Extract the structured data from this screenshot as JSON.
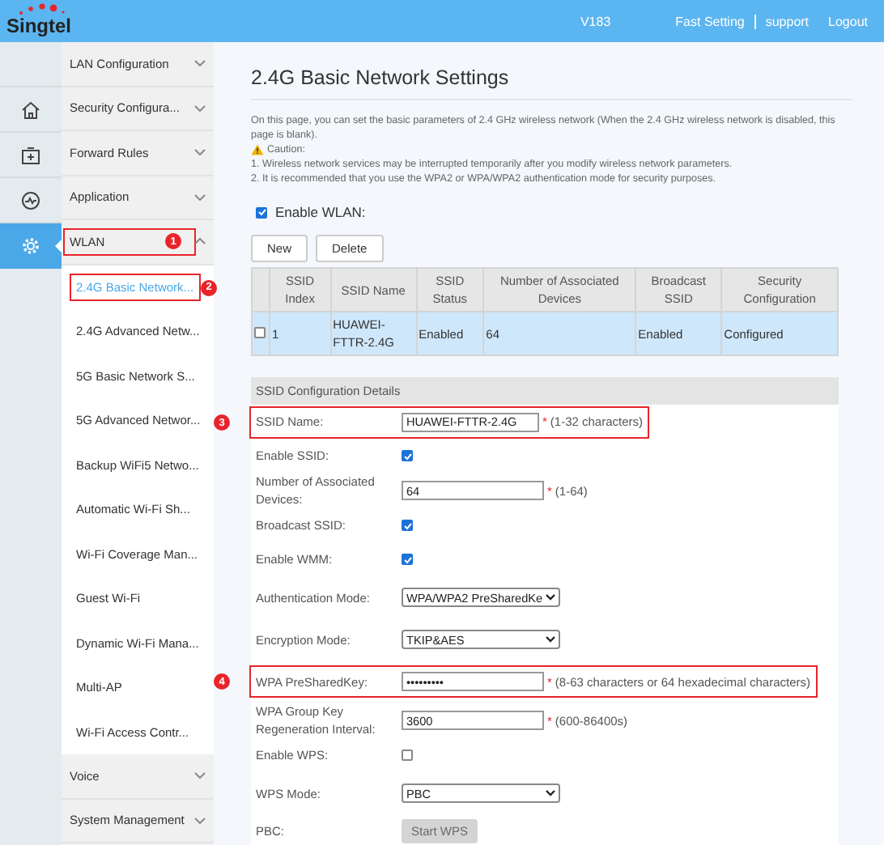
{
  "header": {
    "brand": "Singtel",
    "version": "V183",
    "links": [
      "Fast Setting",
      "support",
      "Logout"
    ]
  },
  "rail": [
    {
      "selected": false
    },
    {
      "selected": false
    },
    {
      "selected": false
    },
    {
      "selected": false
    },
    {
      "selected": true
    }
  ],
  "menu": [
    {
      "label": "LAN Configuration",
      "expanded": false
    },
    {
      "label": "Security Configura...",
      "expanded": false
    },
    {
      "label": "Forward Rules",
      "expanded": false
    },
    {
      "label": "Application",
      "expanded": false
    },
    {
      "label": "WLAN",
      "expanded": true,
      "annotation": "1",
      "children": [
        {
          "label": "2.4G Basic Network...",
          "selected": true,
          "annotation": "2"
        },
        {
          "label": "2.4G Advanced Netw...",
          "selected": false
        },
        {
          "label": "5G Basic Network S...",
          "selected": false
        },
        {
          "label": "5G Advanced Networ...",
          "selected": false
        },
        {
          "label": "Backup WiFi5 Netwo...",
          "selected": false
        },
        {
          "label": "Automatic Wi-Fi Sh...",
          "selected": false
        },
        {
          "label": "Wi-Fi Coverage Man...",
          "selected": false
        },
        {
          "label": "Guest Wi-Fi",
          "selected": false
        },
        {
          "label": "Dynamic Wi-Fi Mana...",
          "selected": false
        },
        {
          "label": "Multi-AP",
          "selected": false
        },
        {
          "label": "Wi-Fi Access Contr...",
          "selected": false
        }
      ]
    },
    {
      "label": "Voice",
      "expanded": false
    },
    {
      "label": "System Management",
      "expanded": false
    }
  ],
  "page": {
    "title": "2.4G Basic Network Settings",
    "intro": "On this page, you can set the basic parameters of 2.4 GHz wireless network (When the 2.4 GHz wireless network is disabled, this page is blank).",
    "caution": "Caution:",
    "notes": [
      "1. Wireless network services may be interrupted temporarily after you modify wireless network parameters.",
      "2. It is recommended that you use the WPA2 or WPA/WPA2 authentication mode for security purposes."
    ],
    "enable_wlan": {
      "label": "Enable WLAN:",
      "checked": true
    },
    "buttons": [
      "New",
      "Delete"
    ],
    "table": {
      "columns": [
        "SSID Index",
        "SSID Name",
        "SSID Status",
        "Number of Associated Devices",
        "Broadcast SSID",
        "Security Configuration"
      ],
      "rows": [
        {
          "checked": false,
          "selected": true,
          "cells": [
            "1",
            "HUAWEI-FTTR-2.4G",
            "Enabled",
            "64",
            "Enabled",
            "Configured"
          ]
        }
      ]
    },
    "details": {
      "title": "SSID Configuration Details",
      "fields": [
        {
          "kind": "text",
          "label": "SSID Name:",
          "value": "HUAWEI-FTTR-2.4G",
          "required": "*",
          "hint": "(1-32 characters)",
          "annotation": "3"
        },
        {
          "kind": "checkbox",
          "label": "Enable SSID:",
          "checked": true
        },
        {
          "kind": "text",
          "label": "Number of Associated Devices:",
          "value": "64",
          "required": "*",
          "hint": "(1-64)"
        },
        {
          "kind": "checkbox",
          "label": "Broadcast SSID:",
          "checked": true
        },
        {
          "kind": "checkbox",
          "label": "Enable WMM:",
          "checked": true
        },
        {
          "kind": "select",
          "label": "Authentication Mode:",
          "value": "WPA/WPA2 PreSharedKe"
        },
        {
          "kind": "select",
          "label": "Encryption Mode:",
          "value": "TKIP&AES"
        },
        {
          "kind": "password",
          "label": "WPA PreSharedKey:",
          "value": "•••••••••",
          "required": "*",
          "hint": "(8-63 characters or 64 hexadecimal characters)",
          "annotation": "4"
        },
        {
          "kind": "text",
          "label": "WPA Group Key Regeneration Interval:",
          "value": "3600",
          "required": "*",
          "hint": "(600-86400s)"
        },
        {
          "kind": "checkbox",
          "label": "Enable WPS:",
          "checked": false
        },
        {
          "kind": "select",
          "label": "WPS Mode:",
          "value": "PBC"
        },
        {
          "kind": "button",
          "label": "PBC:",
          "value": "Start WPS",
          "disabled": true
        }
      ]
    }
  }
}
